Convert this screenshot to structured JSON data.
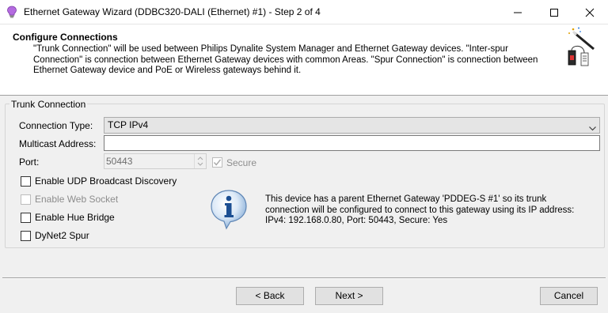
{
  "window": {
    "title": "Ethernet Gateway Wizard (DDBC320-DALI (Ethernet) #1) - Step 2 of 4",
    "icon": "lightbulb-icon"
  },
  "header": {
    "title": "Configure Connections",
    "description": "\"Trunk Connection\" will be used between Philips Dynalite System Manager and Ethernet Gateway devices. \"Inter-spur Connection\" is connection between Ethernet Gateway devices with common Areas. \"Spur Connection\" is connection between Ethernet Gateway device and PoE or Wireless gateways behind it.",
    "icon": "wizard-wand-icon"
  },
  "trunk": {
    "group_title": "Trunk Connection",
    "connection_type_label": "Connection Type:",
    "connection_type_value": "TCP IPv4",
    "multicast_label": "Multicast Address:",
    "multicast_value": "",
    "port_label": "Port:",
    "port_value": "50443",
    "secure_label": "Secure",
    "secure_checked": true,
    "options": [
      {
        "label": "Enable UDP Broadcast Discovery",
        "enabled": true,
        "checked": false
      },
      {
        "label": "Enable Web Socket",
        "enabled": false,
        "checked": false
      },
      {
        "label": "Enable Hue Bridge",
        "enabled": true,
        "checked": false
      },
      {
        "label": "DyNet2 Spur",
        "enabled": true,
        "checked": false
      }
    ],
    "info_text": "This device has a parent Ethernet Gateway 'PDDEG-S #1' so its trunk connection will be configured to connect to this gateway using its IP address: IPv4: 192.168.0.80, Port: 50443, Secure: Yes"
  },
  "buttons": {
    "back": "< Back",
    "next": "Next >",
    "cancel": "Cancel"
  },
  "colors": {
    "header_bg": "#ffffff",
    "dialog_bg": "#f0f0f0",
    "close_hover": "#e81123"
  }
}
